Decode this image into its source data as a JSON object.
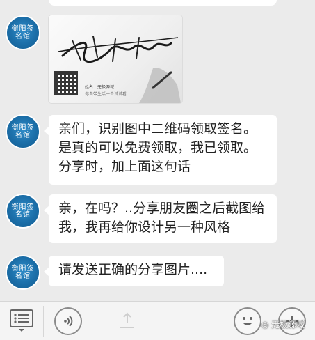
{
  "messages": [
    {
      "type": "image",
      "avatar_text": "衡阳签名馆",
      "card": {
        "signature_text": "无极源域",
        "name_line": "姓名：无极源域",
        "sub_line": "你自带生活一个试试看"
      }
    },
    {
      "type": "text",
      "avatar_text": "衡阳签名馆",
      "text": "亲们，识别图中二维码领取签名。是真的可以免费领取，我已领取。分享时，加上面这句话"
    },
    {
      "type": "text",
      "avatar_text": "衡阳签名馆",
      "text": "亲，在吗？..分享朋友圈之后截图给我，我再给你设计另一种风格"
    },
    {
      "type": "text",
      "avatar_text": "衡阳签名馆",
      "text": "请发送正确的分享图片...."
    }
  ],
  "toolbar": {
    "menu_icon": "menu-list-icon",
    "voice_icon": "voice-icon",
    "emoji_icon": "emoji-icon",
    "more_icon": "more-icon"
  },
  "watermark": "无极源域"
}
